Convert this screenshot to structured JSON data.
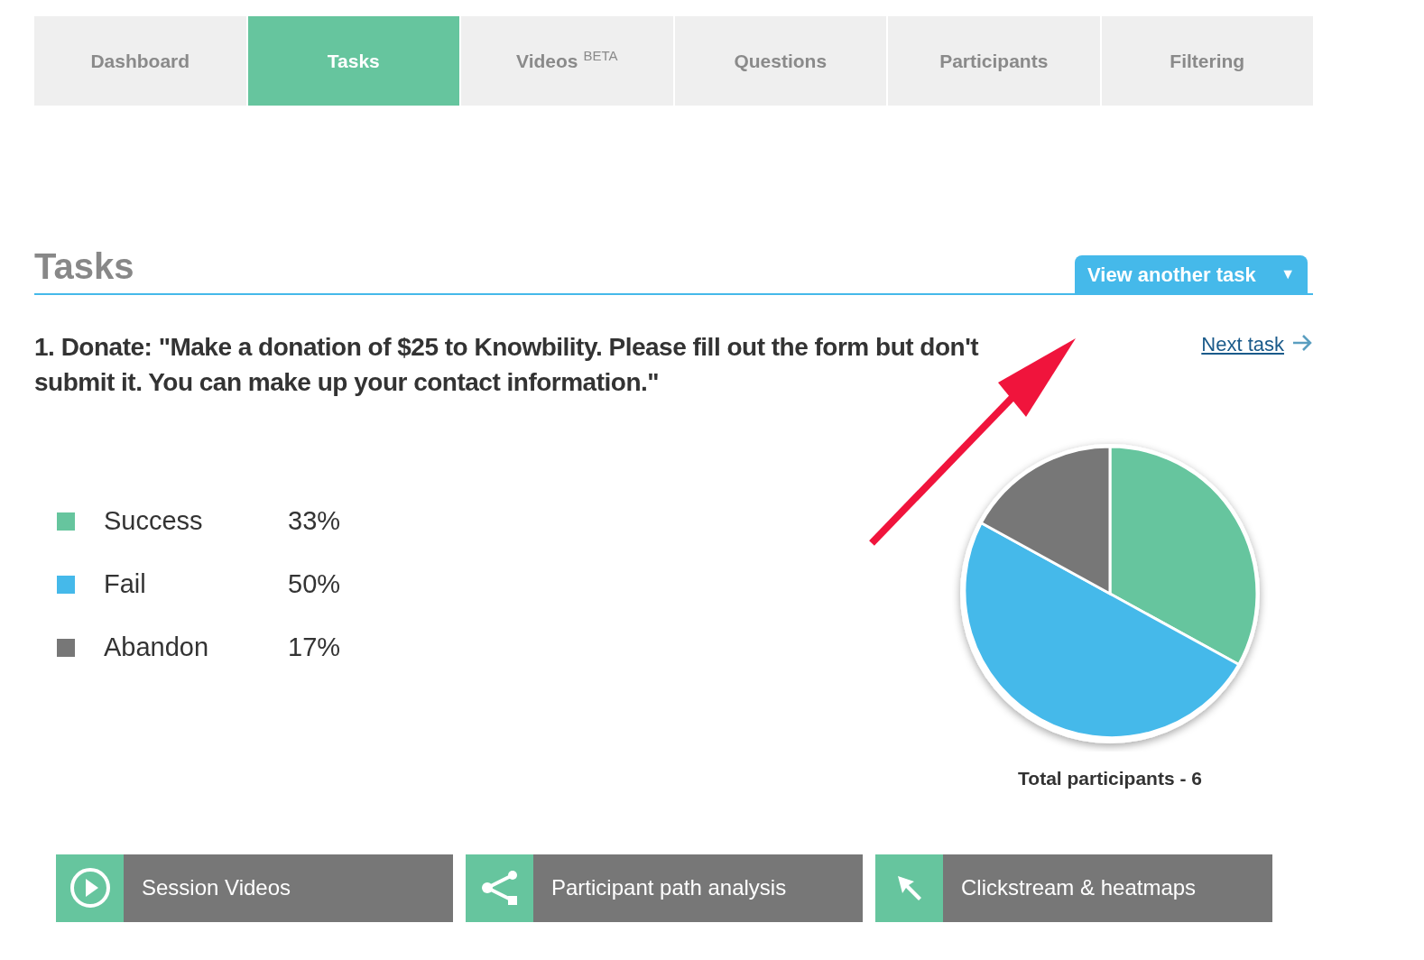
{
  "tabs": [
    {
      "label": "Dashboard",
      "selected": false
    },
    {
      "label": "Tasks",
      "selected": true
    },
    {
      "label": "Videos",
      "sup": "BETA",
      "selected": false
    },
    {
      "label": "Questions",
      "selected": false
    },
    {
      "label": "Participants",
      "selected": false
    },
    {
      "label": "Filtering",
      "selected": false
    }
  ],
  "section": {
    "title": "Tasks",
    "dropdown": "View another task",
    "caret": "▼"
  },
  "task": {
    "text": "1. Donate: \"Make a donation of $25 to Knowbility. Please fill out the form but don't submit it. You can make up your contact information.\"",
    "next": "Next task"
  },
  "legend": [
    {
      "value": "33%",
      "color": "#66c59e"
    },
    {
      "value": "50%",
      "color": "#45b9ea"
    },
    {
      "value": "17%",
      "color": "#777777"
    }
  ],
  "chart_data": {
    "type": "pie",
    "categories": [
      "Success",
      "Fail",
      "Abandon"
    ],
    "values": [
      33,
      50,
      17
    ]
  },
  "total": "Total participants - 6",
  "actions": [
    {
      "kind": "play",
      "label": "Session Videos"
    },
    {
      "kind": "share",
      "label": "Participant path analysis"
    },
    {
      "kind": "cursor",
      "label": "Clickstream & heatmaps"
    }
  ]
}
